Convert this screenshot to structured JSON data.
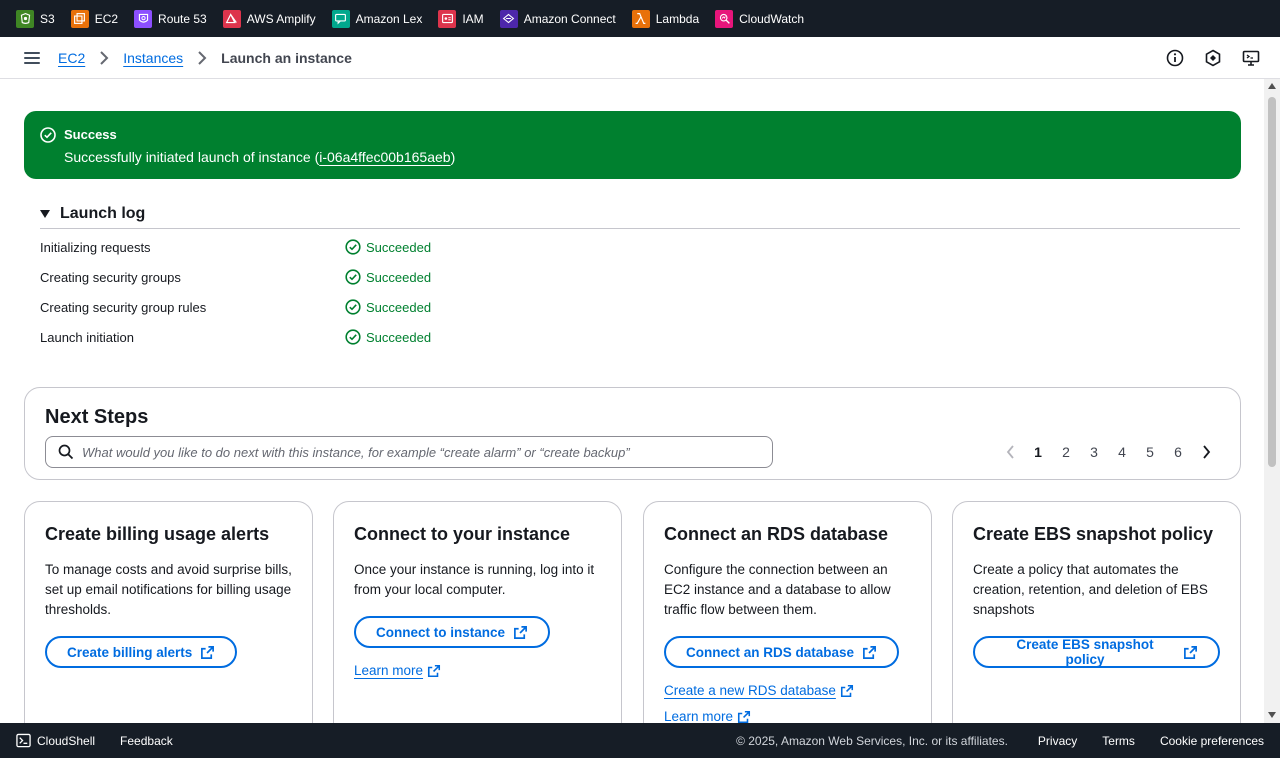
{
  "services_bar": {
    "items": [
      {
        "label": "S3",
        "icon": "s3-icon",
        "color": "#3f8624"
      },
      {
        "label": "EC2",
        "icon": "ec2-icon",
        "color": "#e8710a"
      },
      {
        "label": "Route 53",
        "icon": "route53-icon",
        "color": "#8c4fff"
      },
      {
        "label": "AWS Amplify",
        "icon": "amplify-icon",
        "color": "#dd344c"
      },
      {
        "label": "Amazon Lex",
        "icon": "lex-icon",
        "color": "#01a88d"
      },
      {
        "label": "IAM",
        "icon": "iam-icon",
        "color": "#dd344c"
      },
      {
        "label": "Amazon Connect",
        "icon": "connect-icon",
        "color": "#4d27aa"
      },
      {
        "label": "Lambda",
        "icon": "lambda-icon",
        "color": "#e8710a"
      },
      {
        "label": "CloudWatch",
        "icon": "cloudwatch-icon",
        "color": "#e7157b"
      }
    ]
  },
  "breadcrumb": {
    "items": [
      "EC2",
      "Instances"
    ],
    "current": "Launch an instance"
  },
  "banner": {
    "title": "Success",
    "message_prefix": "Successfully initiated launch of instance (",
    "instance_id": "i-06a4ffec00b165aeb",
    "message_suffix": ")",
    "color": "#00802f"
  },
  "launch_log": {
    "title": "Launch log",
    "rows": [
      {
        "name": "Initializing requests",
        "status": "Succeeded"
      },
      {
        "name": "Creating security groups",
        "status": "Succeeded"
      },
      {
        "name": "Creating security group rules",
        "status": "Succeeded"
      },
      {
        "name": "Launch initiation",
        "status": "Succeeded"
      }
    ]
  },
  "next_steps": {
    "title": "Next Steps",
    "search_placeholder": "What would you like to do next with this instance, for example “create alarm” or “create backup”",
    "pages": [
      "1",
      "2",
      "3",
      "4",
      "5",
      "6"
    ],
    "current_page": "1"
  },
  "cards": [
    {
      "title": "Create billing usage alerts",
      "description": "To manage costs and avoid surprise bills, set up email notifications for billing usage thresholds.",
      "button": "Create billing alerts",
      "links": []
    },
    {
      "title": "Connect to your instance",
      "description": "Once your instance is running, log into it from your local computer.",
      "button": "Connect to instance",
      "links": [
        "Learn more"
      ]
    },
    {
      "title": "Connect an RDS database",
      "description": "Configure the connection between an EC2 instance and a database to allow traffic flow between them.",
      "button": "Connect an RDS database",
      "links": [
        "Create a new RDS database",
        "Learn more"
      ]
    },
    {
      "title": "Create EBS snapshot policy",
      "description": "Create a policy that automates the creation, retention, and deletion of EBS snapshots",
      "button": "Create EBS snapshot policy",
      "links": []
    }
  ],
  "footer": {
    "cloudshell": "CloudShell",
    "feedback": "Feedback",
    "copyright": "© 2025, Amazon Web Services, Inc. or its affiliates.",
    "links": [
      "Privacy",
      "Terms",
      "Cookie preferences"
    ]
  }
}
